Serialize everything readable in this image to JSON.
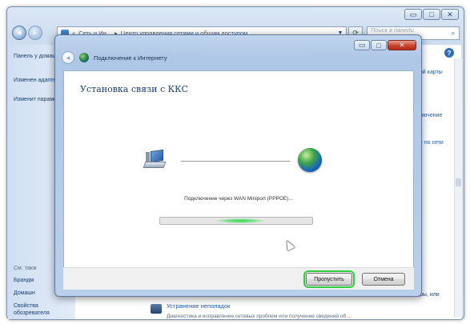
{
  "window": {
    "address_parts": [
      "«",
      "Сеть и Ин...",
      "▸",
      "Центр управления сетями и общим доступом"
    ],
    "search_placeholder": "Поиск в панели управления",
    "left_links": [
      "Панель у домашн",
      "Изменен адаптера",
      "Изменит параметр"
    ],
    "see_also": "См. такж",
    "bottom_left_links": [
      "Брандм",
      "Домашн",
      "Свойства обозревателя"
    ],
    "right_links": [
      "ой карты",
      "лючение",
      "е по сети",
      "ры, или"
    ],
    "troubleshoot_title": "Устранение неполадок",
    "troubleshoot_desc": "Диагностика и исправление сетевых проблем или получение сведений об ..."
  },
  "dialog": {
    "title": "Подключение к Интернету",
    "heading": "Установка связи с ККС",
    "status": "Подключение через WAN Miniport (PPPOE)...",
    "progress_indeterminate": true,
    "skip_button": "Пропустить",
    "cancel_button": "Отмена"
  },
  "colors": {
    "accent": "#2ecc40",
    "link": "#1d5aa8",
    "close_button": "#c8432b"
  },
  "icons": {
    "back": "back-arrow-icon",
    "forward": "forward-arrow-icon",
    "network": "network-globe-icon",
    "computer": "computer-icon",
    "search": "search-icon",
    "help": "help-icon"
  }
}
